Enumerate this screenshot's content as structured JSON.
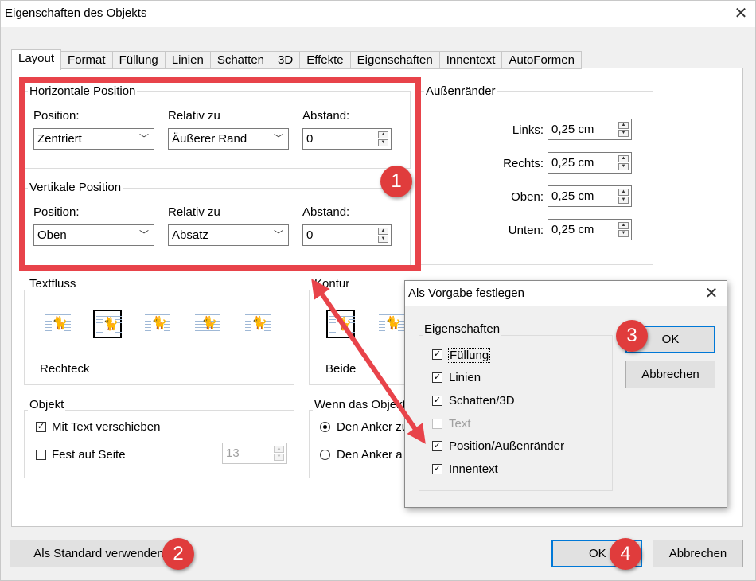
{
  "window": {
    "title": "Eigenschaften des Objekts"
  },
  "tabs": [
    "Layout",
    "Format",
    "Füllung",
    "Linien",
    "Schatten",
    "3D",
    "Effekte",
    "Eigenschaften",
    "Innentext",
    "AutoFormen"
  ],
  "horizontal": {
    "title": "Horizontale Position",
    "position_label": "Position:",
    "position_value": "Zentriert",
    "relative_label": "Relativ zu",
    "relative_value": "Äußerer Rand",
    "distance_label": "Abstand:",
    "distance_value": "0"
  },
  "vertical": {
    "title": "Vertikale Position",
    "position_label": "Position:",
    "position_value": "Oben",
    "relative_label": "Relativ zu",
    "relative_value": "Absatz",
    "distance_label": "Abstand:",
    "distance_value": "0"
  },
  "margins": {
    "title": "Außenränder",
    "left_label": "Links:",
    "left_value": "0,25 cm",
    "right_label": "Rechts:",
    "right_value": "0,25 cm",
    "top_label": "Oben:",
    "top_value": "0,25 cm",
    "bottom_label": "Unten:",
    "bottom_value": "0,25 cm"
  },
  "textflow": {
    "title": "Textfluss",
    "selected_label": "Rechteck"
  },
  "contour": {
    "title": "Kontur",
    "selected_label": "Beide"
  },
  "object": {
    "title": "Objekt",
    "move_with_text": "Mit Text verschieben",
    "fixed_on_page": "Fest auf Seite",
    "page_value": "13"
  },
  "anchor": {
    "title": "Wenn das Objekt",
    "option1": "Den Anker zu",
    "option2": "Den Anker a"
  },
  "subdialog": {
    "title": "Als Vorgabe festlegen",
    "group_title": "Eigenschaften",
    "items": [
      "Füllung",
      "Linien",
      "Schatten/3D",
      "Text",
      "Position/Außenränder",
      "Innentext"
    ],
    "ok": "OK",
    "cancel": "Abbrechen"
  },
  "footer": {
    "default_button": "Als Standard verwenden",
    "ok": "OK",
    "cancel": "Abbrechen"
  },
  "badges": [
    "1",
    "2",
    "3",
    "4"
  ],
  "colors": {
    "annotation_red": "#e8434a",
    "focus_blue": "#0078d7"
  }
}
